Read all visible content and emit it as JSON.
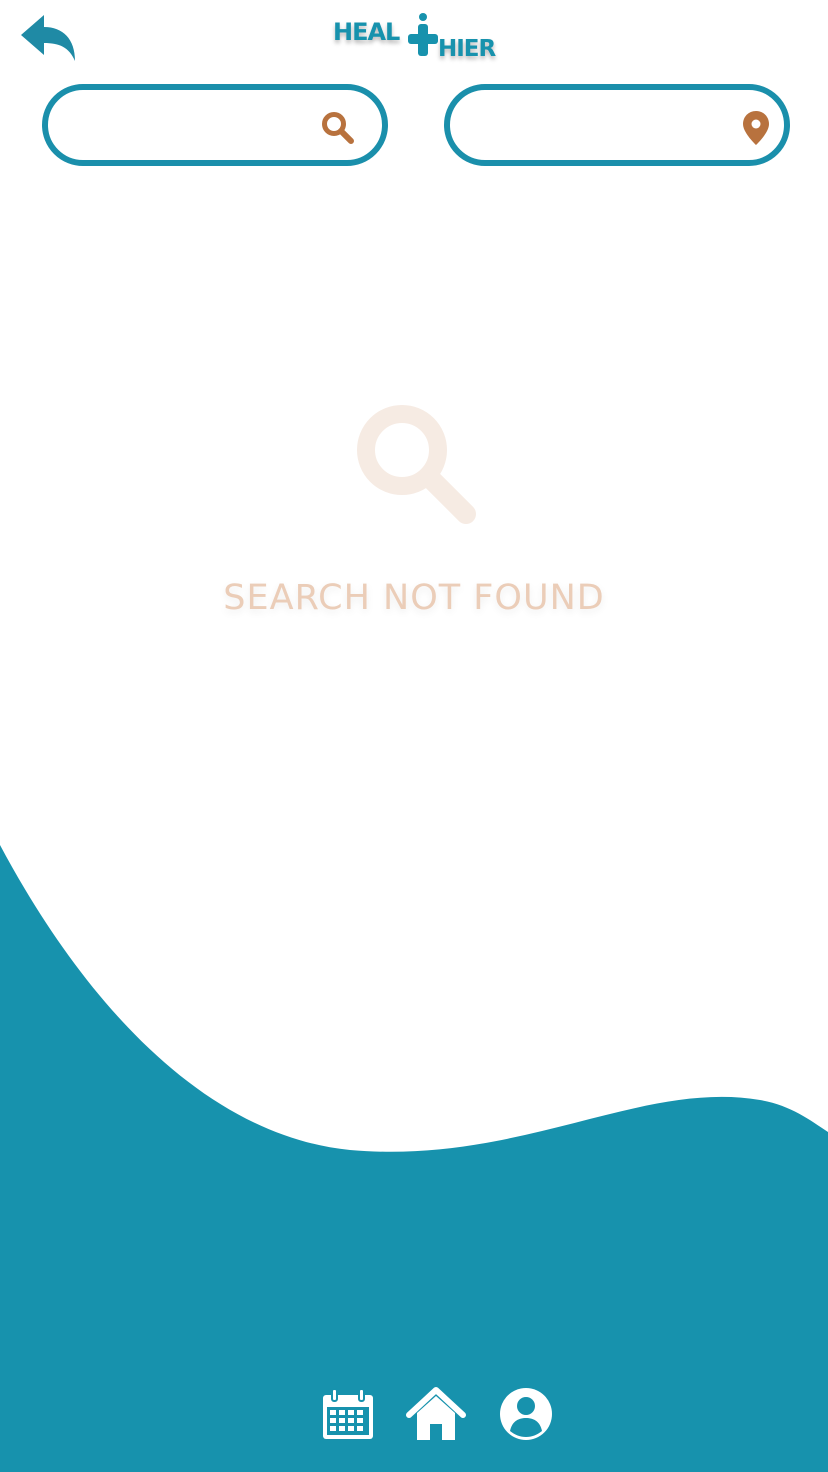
{
  "app": {
    "logo_text_top": "HEAL",
    "logo_text_bottom": "HIER"
  },
  "header": {
    "back_icon": "reply-arrow-icon"
  },
  "search": {
    "query_value": "",
    "location_value": "",
    "search_icon": "search-icon",
    "location_icon": "map-pin-icon"
  },
  "empty_state": {
    "icon": "search-icon",
    "message": "SEARCH NOT FOUND"
  },
  "bottom_nav": {
    "items": [
      {
        "name": "calendar",
        "icon": "calendar-icon"
      },
      {
        "name": "home",
        "icon": "home-icon"
      },
      {
        "name": "profile",
        "icon": "user-circle-icon"
      }
    ]
  },
  "colors": {
    "brand_teal": "#1a8fab",
    "accent_copper": "#b8723e",
    "empty_text": "#ebcdb8",
    "empty_icon": "#f6ebe3",
    "background": "#ffffff"
  }
}
